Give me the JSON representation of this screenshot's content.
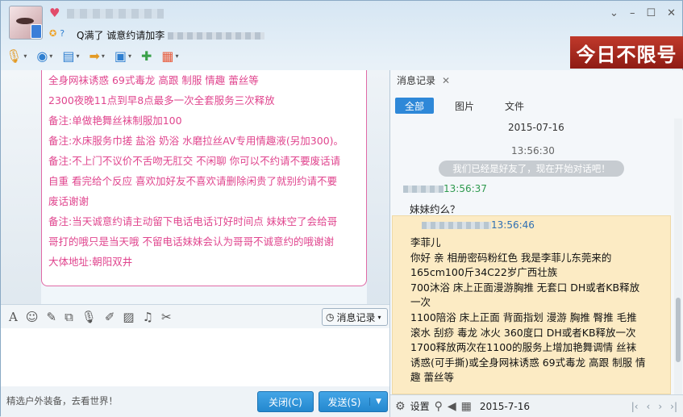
{
  "header": {
    "heart_icon": "♥",
    "signature_prefix": "Q满了 诚意约请加李"
  },
  "window_buttons": [
    "⌄",
    "–",
    "☐",
    "✕"
  ],
  "toolbar": {
    "caret": "▾"
  },
  "ad": {
    "text": "今日不限号"
  },
  "message_lines": [
    "全身网袜诱惑 69式毒龙 高跟 制服 情趣 蕾丝等",
    "2300夜晚11点到早8点最多一次全套服务三次释放",
    "备注:单做艳舞丝袜制服加100",
    "备注:水床服务巾搓 盐浴 奶浴 水磨拉丝AV专用情趣液(另加300)。",
    "备注:不上门不议价不舌吻无肛交 不闲聊 你可以不约请不要废话请",
    "自重 看完给个反应 喜欢加好友不喜欢请删除闲贵了就别约请不要",
    "废话谢谢",
    "备注:当天诚意约请主动留下电话电话订好时间点 妹妹空了会给哥",
    "哥打的哦只是当天哦 不留电话妹妹会认为哥哥不诚意约的哦谢谢",
    "大体地址:朝阳双井"
  ],
  "input_toolbar": {
    "history_button": "消息记录"
  },
  "bottom": {
    "promo": "精选户外装备，去看世界！",
    "close_label": "关闭(C)",
    "send_label": "发送(S)",
    "send_arrow": "▼"
  },
  "history": {
    "tab_label": "消息记录",
    "tab_close": "✕",
    "filters": [
      "全部",
      "图片",
      "文件"
    ],
    "date": "2015-07-16",
    "time1": "13:56:30",
    "system_msg": "我们已经是好友了，现在开始对话吧！",
    "sender1_time": "13:56:37",
    "msg1": "妹妹约么？",
    "sender2_time": "13:56:46",
    "yellow_lines": [
      "李菲儿",
      "你好 亲 相册密码粉红色  我是李菲儿东莞来的",
      "165cm100斤34C22岁广西壮族",
      "700沐浴 床上正面漫游胸推 无套口 DH或者KB释放",
      "一次",
      "1100陪浴 床上正面 背面指划 漫游 胸推 臀推 毛推",
      "滚水 刮痧 毒龙 冰火  360度口 DH或者KB释放一次",
      "1700释放两次在1100的服务上增加艳舞调情 丝袜",
      "诱惑(可手撕)或全身网袜诱惑 69式毒龙 高跟 制服 情",
      "趣 蕾丝等"
    ],
    "footer": {
      "settings": "设置",
      "date": "2015-7-16",
      "nav": [
        "|‹",
        "‹",
        "›",
        "›|"
      ]
    }
  },
  "colors": {
    "accent": "#2e88d8",
    "pink_text": "#e0458e",
    "ad_red": "#c0392b"
  },
  "icons": [
    "microphone-icon",
    "camera-icon",
    "screen-share-icon",
    "file-transfer-icon",
    "remote-desktop-icon",
    "add-chat-icon",
    "apps-icon"
  ]
}
